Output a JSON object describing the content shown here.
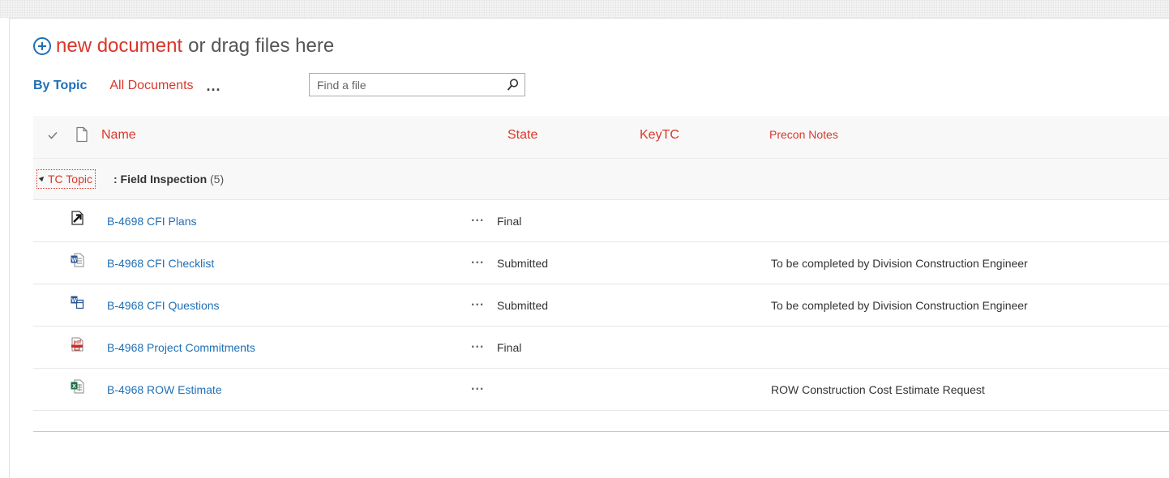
{
  "toolbar": {
    "new_document_link": "new document",
    "new_document_rest": "or drag files here"
  },
  "views": {
    "by_topic": "By Topic",
    "all_documents": "All Documents",
    "more": "..."
  },
  "search": {
    "placeholder": "Find a file",
    "value": ""
  },
  "columns": {
    "name": "Name",
    "state": "State",
    "keytc": "KeyTC",
    "precon_notes": "Precon Notes"
  },
  "group": {
    "field": "TC Topic",
    "separator": ": Field Inspection",
    "count": "(5)"
  },
  "rows": [
    {
      "name": "B-4698 CFI Plans",
      "more": "...",
      "state": "Final",
      "notes": "",
      "icon": "link-document-icon"
    },
    {
      "name": "B-4968 CFI Checklist",
      "more": "...",
      "state": "Submitted",
      "notes": "To be completed by Division Construction Engineer",
      "icon": "word-document-icon"
    },
    {
      "name": "B-4968 CFI Questions",
      "more": "...",
      "state": "Submitted",
      "notes": "To be completed by Division Construction Engineer",
      "icon": "word-form-icon"
    },
    {
      "name": "B-4968 Project Commitments",
      "more": "...",
      "state": "Final",
      "notes": "",
      "icon": "pdf-document-icon"
    },
    {
      "name": "B-4968 ROW Estimate",
      "more": "...",
      "state": "",
      "notes": "ROW Construction Cost Estimate Request",
      "icon": "excel-document-icon"
    }
  ],
  "colors": {
    "accent_blue": "#1f6fb5",
    "accent_red": "#d9372a"
  }
}
